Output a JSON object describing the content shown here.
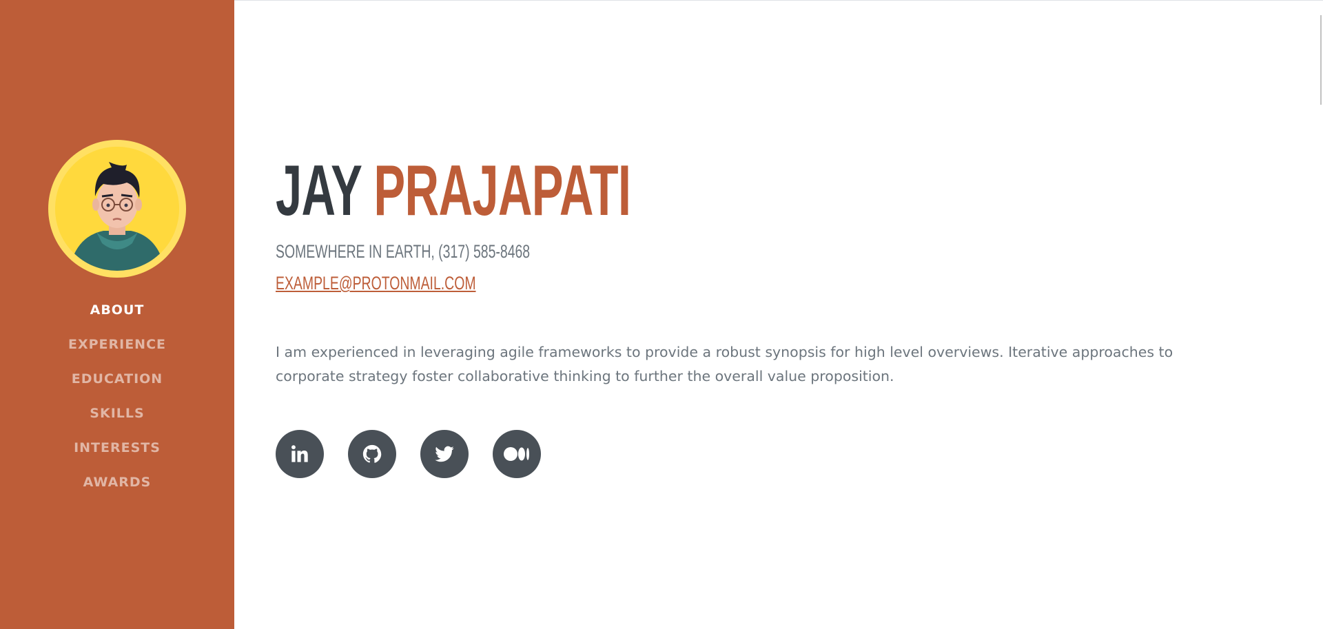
{
  "sidebar": {
    "nav": [
      {
        "label": "About",
        "active": true
      },
      {
        "label": "Experience",
        "active": false
      },
      {
        "label": "Education",
        "active": false
      },
      {
        "label": "Skills",
        "active": false
      },
      {
        "label": "Interests",
        "active": false
      },
      {
        "label": "Awards",
        "active": false
      }
    ]
  },
  "about": {
    "first_name": "JAY",
    "last_name": "PRAJAPATI",
    "subheading": "SOMEWHERE IN EARTH, (317) 585-8468",
    "email": "EXAMPLE@PROTONMAIL.COM",
    "lead": "I am experienced in leveraging agile frameworks to provide a robust synopsis for high level overviews. Iterative approaches to corporate strategy foster collaborative thinking to further the overall value proposition."
  },
  "social": [
    {
      "icon": "linkedin-icon"
    },
    {
      "icon": "github-icon"
    },
    {
      "icon": "twitter-icon"
    },
    {
      "icon": "medium-icon"
    }
  ],
  "colors": {
    "primary": "#bd5d38",
    "dark": "#343a40",
    "text": "#6c757d",
    "social_bg": "#495057"
  }
}
